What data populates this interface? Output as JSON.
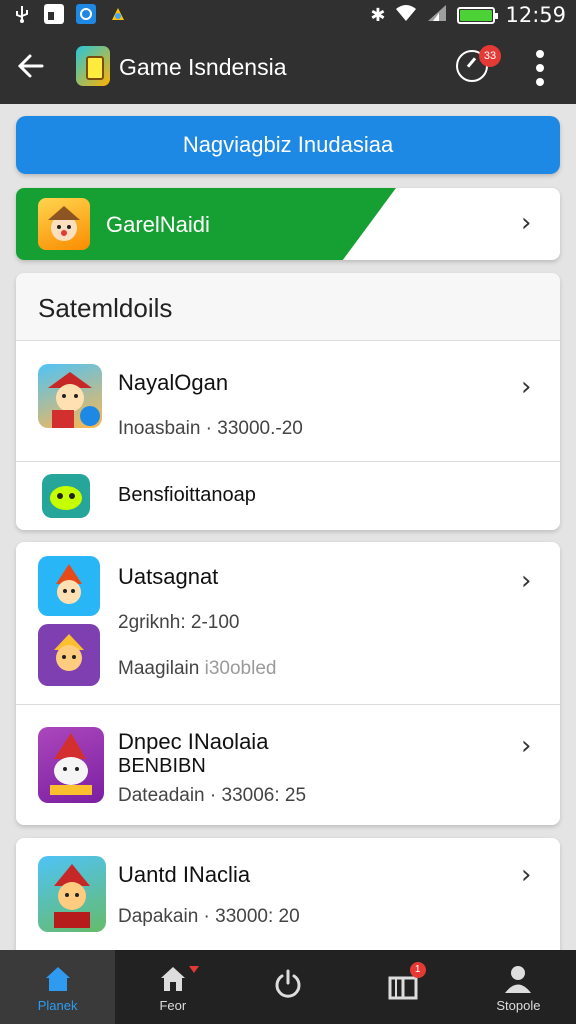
{
  "status_bar": {
    "time": "12:59",
    "icons": [
      "usb-icon",
      "image-icon",
      "sync-icon",
      "game-icon",
      "bluetooth-icon",
      "wifi-icon",
      "signal-icon",
      "battery-icon"
    ]
  },
  "app_bar": {
    "title": "Game Isndensia",
    "notification_count": "33"
  },
  "nav_button": {
    "label": "Nagviagbiz Inudasiaa"
  },
  "banner": {
    "label": "GarelNaidi"
  },
  "section": {
    "title": "Satemldoils",
    "items": [
      {
        "title": "NayalOgan",
        "subtitle": "Inoasbain · 33000.-20"
      },
      {
        "title": "Bensfioittanoap"
      }
    ]
  },
  "group": {
    "items": [
      {
        "title": "Uatsagnat",
        "subtitle": "2griknh: 2-100",
        "extra_prefix": "Maagilain",
        "extra_value": "i30obled"
      },
      {
        "title": "Dnpec INaolaia",
        "title2": "BENBIBN",
        "subtitle": "Dateadain · 33006: 25"
      }
    ]
  },
  "last_item": {
    "title": "Uantd INaclia",
    "subtitle": "Dapakain · 33000: 20"
  },
  "bottom_nav": {
    "tabs": [
      {
        "label": "Planek",
        "active": true
      },
      {
        "label": "Feor",
        "badge": true
      },
      {
        "label": ""
      },
      {
        "label": "",
        "badge_count": "1"
      },
      {
        "label": "Stopole"
      }
    ]
  },
  "colors": {
    "accent": "#1e88e5",
    "banner_green": "#16a034",
    "badge_red": "#e53935",
    "active_tab": "#2e9bf0",
    "status_bar": "#303030"
  }
}
